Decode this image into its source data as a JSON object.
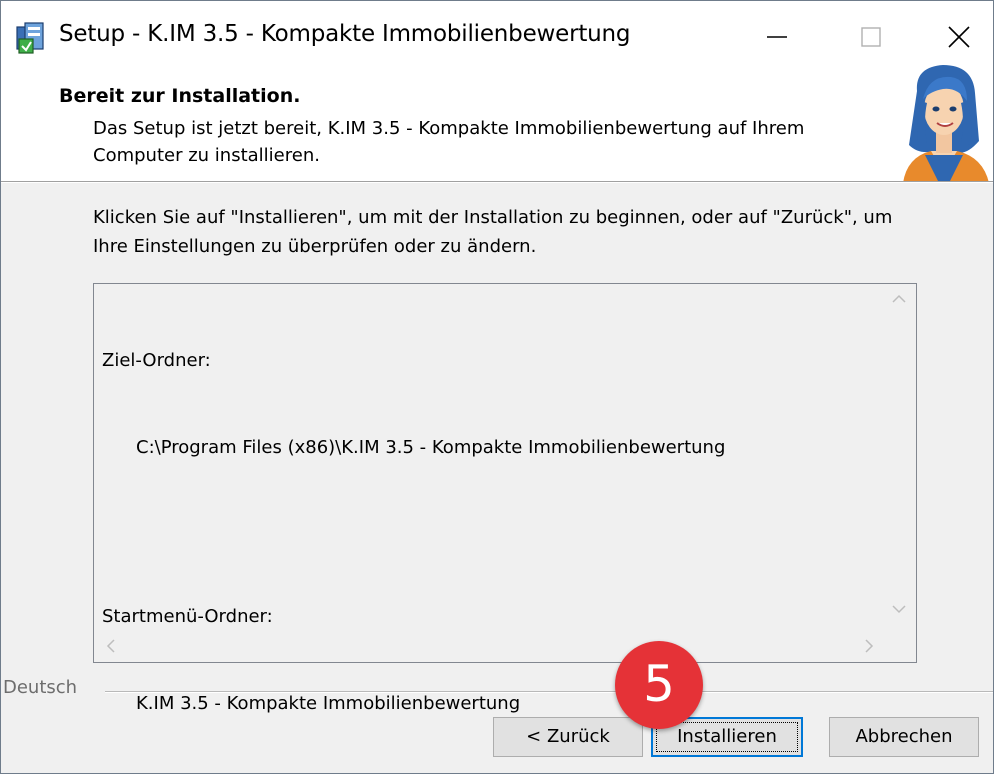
{
  "window": {
    "title": "Setup - K.IM 3.5 - Kompakte Immobilienbewertung"
  },
  "header": {
    "title": "Bereit zur Installation.",
    "description": "Das Setup ist jetzt bereit, K.IM 3.5 - Kompakte Immobilienbewertung auf Ihrem Computer zu installieren."
  },
  "main": {
    "instruction": "Klicken Sie auf \"Installieren\", um mit der Installation zu beginnen, oder auf \"Zurück\", um Ihre Einstellungen zu überprüfen oder zu ändern.",
    "summary": {
      "dest_label": "Ziel-Ordner:",
      "dest_value": "C:\\Program Files (x86)\\K.IM 3.5 - Kompakte Immobilienbewertung",
      "startmenu_label": "Startmenü-Ordner:",
      "startmenu_value": "K.IM 3.5 - Kompakte Immobilienbewertung"
    }
  },
  "footer": {
    "language": "Deutsch",
    "back_label": "< Zurück",
    "install_label": "Installieren",
    "cancel_label": "Abbrechen"
  },
  "annotation": {
    "step": "5",
    "color": "#e53237"
  },
  "icons": {
    "app": "setup-installer-icon",
    "minimize": "minimize-icon",
    "maximize": "maximize-icon",
    "close": "close-icon",
    "mascot": "mascot-woman-illustration"
  },
  "colors": {
    "accent": "#0078d7",
    "badge": "#e53237",
    "dialog_bg": "#f0f0f0"
  }
}
